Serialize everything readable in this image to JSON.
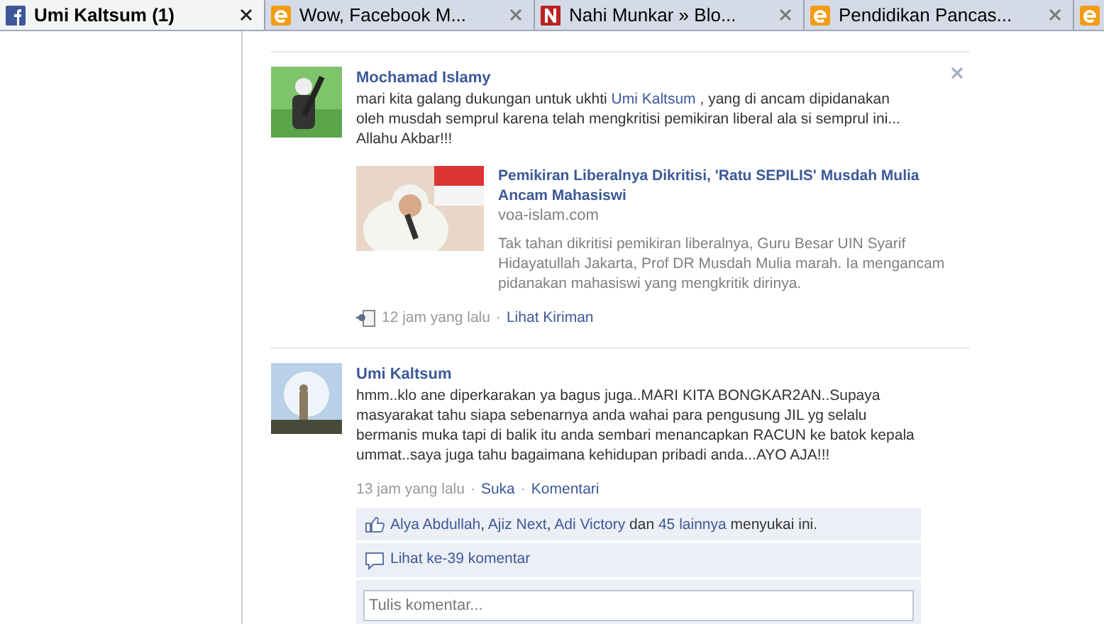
{
  "tabs": [
    {
      "title": "Umi Kaltsum (1)",
      "kind": "facebook",
      "selected": true
    },
    {
      "title": "Wow, Facebook M...",
      "kind": "e",
      "selected": false
    },
    {
      "title": "Nahi Munkar » Blo...",
      "kind": "n",
      "selected": false
    },
    {
      "title": "Pendidikan Pancas...",
      "kind": "e",
      "selected": false
    },
    {
      "kind": "e",
      "selected": false
    }
  ],
  "posts": [
    {
      "author": "Mochamad Islamy",
      "closable": true,
      "text_parts": [
        {
          "kind": "plain",
          "text": "mari kita galang dukungan untuk ukhti "
        },
        {
          "kind": "link",
          "text": "Umi Kaltsum"
        },
        {
          "kind": "plain",
          "text": " , yang di ancam dipidanakan oleh musdah semprul karena telah mengkritisi pemikiran liberal ala si semprul ini... Allahu Akbar!!!"
        }
      ],
      "link_preview": {
        "title": "Pemikiran Liberalnya Dikritisi, 'Ratu SEPILIS' Musdah Mulia Ancam Mahasiswi",
        "domain": "voa-islam.com",
        "description": "Tak tahan dikritisi pemikiran liberalnya, Guru Besar UIN Syarif Hidayatullah Jakarta, Prof DR Musdah Mulia marah. Ia mengancam pidanakan mahasiswi yang mengkritik dirinya."
      },
      "meta_icon": true,
      "time": "12 jam yang lalu",
      "separator": "·",
      "actions": [
        "Lihat Kiriman"
      ]
    },
    {
      "author": "Umi Kaltsum",
      "closable": false,
      "text_parts": [
        {
          "kind": "plain",
          "text": "hmm..klo ane diperkarakan ya bagus juga..MARI KITA BONGKAR2AN..Supaya masyarakat tahu siapa sebenarnya anda wahai para pengusung JIL yg selalu bermanis muka tapi di balik itu anda sembari menancapkan RACUN ke batok kepala ummat..saya juga tahu bagaimana kehidupan pribadi anda...AYO AJA!!!"
        }
      ],
      "meta_icon": false,
      "time": "13 jam yang lalu",
      "separator": "·",
      "actions": [
        "Suka",
        "Komentari"
      ],
      "likes_parts": [
        {
          "kind": "link",
          "text": "Alya Abdullah",
          "after": ", "
        },
        {
          "kind": "link",
          "text": "Ajiz Next",
          "after": ", "
        },
        {
          "kind": "link",
          "text": "Adi Victory"
        },
        {
          "kind": "plain",
          "text": " dan "
        },
        {
          "kind": "link",
          "text": "45 lainnya"
        },
        {
          "kind": "plain",
          "text": " menyukai ini."
        }
      ],
      "comments_link": "Lihat ke-39 komentar",
      "comment_placeholder": "Tulis komentar..."
    }
  ]
}
